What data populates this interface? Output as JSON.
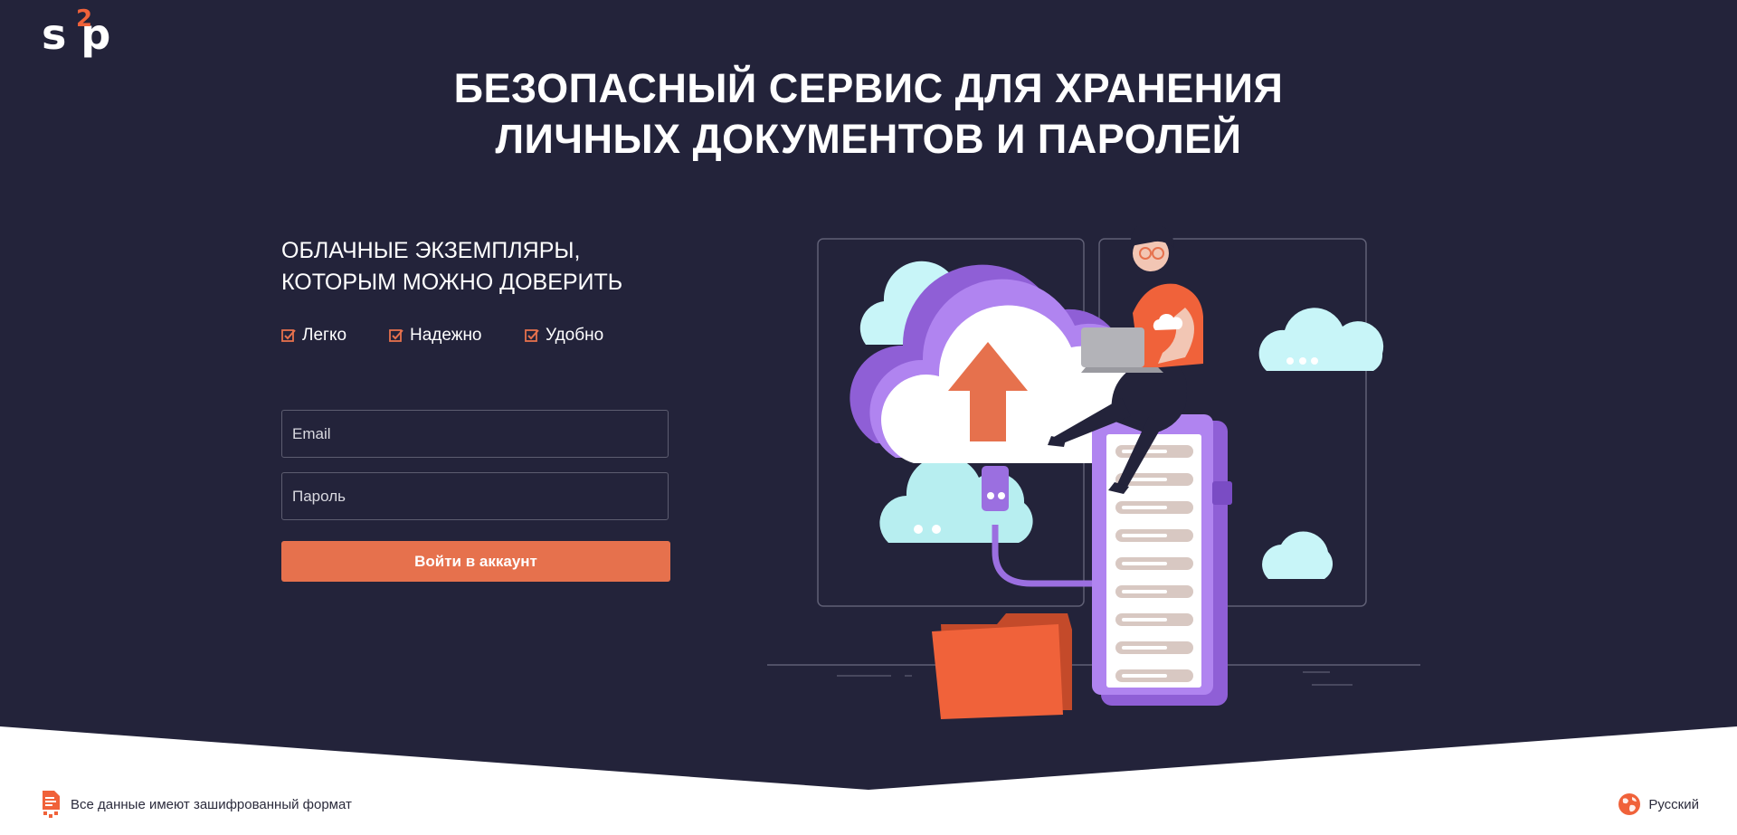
{
  "brand": {
    "logo_main": "s p",
    "logo_sup": "2"
  },
  "hero": {
    "title_line1": "БЕЗОПАСНЫЙ СЕРВИС ДЛЯ ХРАНЕНИЯ",
    "title_line2": "ЛИЧНЫХ ДОКУМЕНТОВ И ПАРОЛЕЙ",
    "subtitle_line1": "ОБЛАЧНЫЕ ЭКЗЕМПЛЯРЫ,",
    "subtitle_line2": "КОТОРЫМ МОЖНО ДОВЕРИТЬ"
  },
  "features": [
    "Легко",
    "Надежно",
    "Удобно"
  ],
  "login": {
    "email_placeholder": "Email",
    "password_placeholder": "Пароль",
    "submit_label": "Войти в аккаунт"
  },
  "footer": {
    "encryption_note": "Все данные имеют зашифрованный формат",
    "language": "Русский"
  },
  "colors": {
    "background": "#23233a",
    "accent": "#e6714d",
    "illustration_purple": "#9b6fe0",
    "illustration_cloud": "#c8f5f8"
  },
  "icons": [
    "check-icon",
    "cloud-upload-illustration",
    "document-lock-icon",
    "globe-icon"
  ]
}
